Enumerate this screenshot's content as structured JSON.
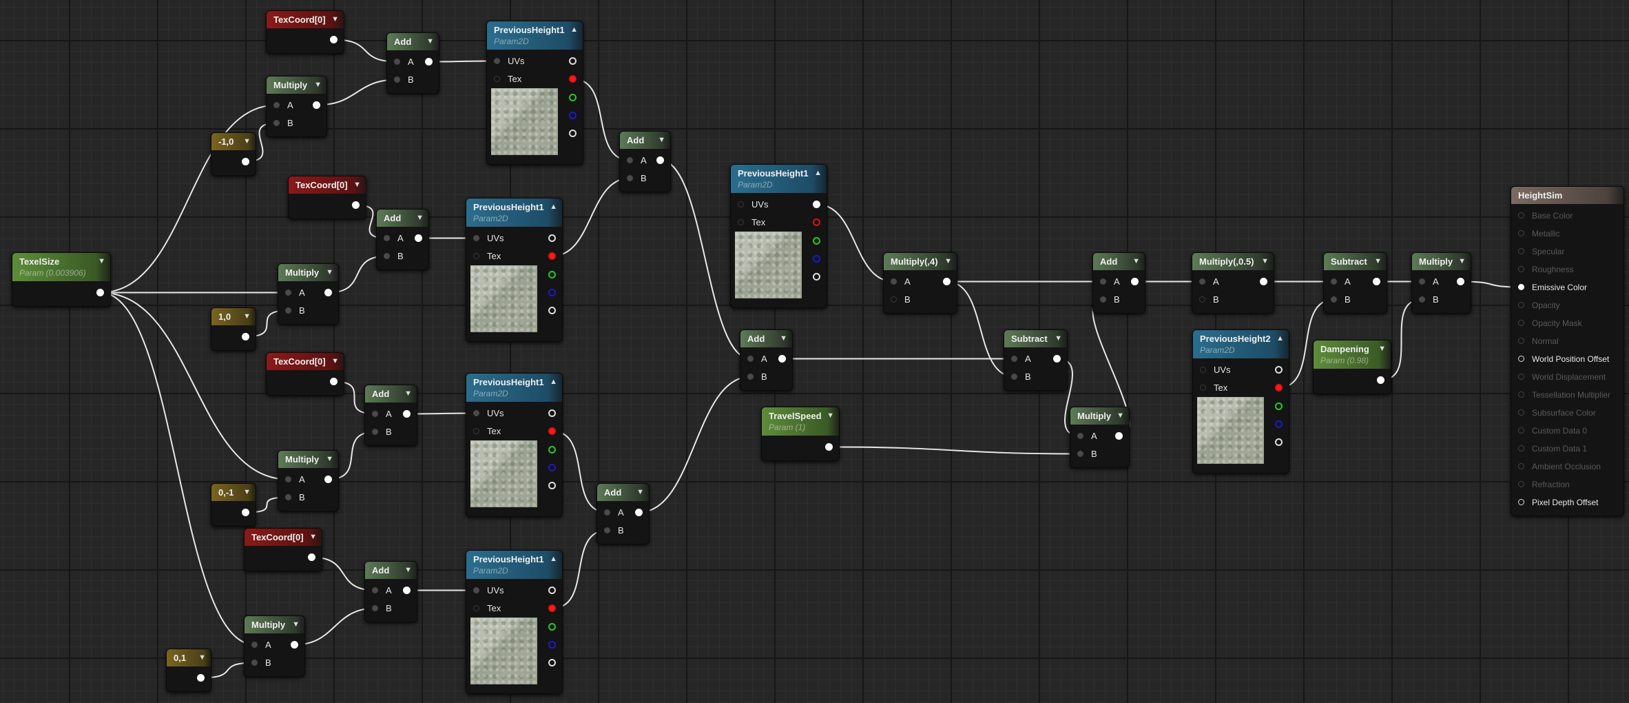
{
  "nodes": [
    {
      "kind": "texcoord",
      "title": "TexCoord[0]"
    },
    {
      "kind": "math",
      "title": "Add",
      "inputs": [
        "A",
        "B"
      ]
    },
    {
      "kind": "texture",
      "title": "PreviousHeight1",
      "subtitle": "Param2D",
      "inputs": [
        "UVs",
        "Tex"
      ]
    },
    {
      "kind": "math",
      "title": "Multiply",
      "inputs": [
        "A",
        "B"
      ]
    },
    {
      "kind": "const",
      "title": "-1,0"
    },
    {
      "kind": "math",
      "title": "Add",
      "inputs": [
        "A",
        "B"
      ]
    },
    {
      "kind": "texcoord",
      "title": "TexCoord[0]"
    },
    {
      "kind": "math",
      "title": "Add",
      "inputs": [
        "A",
        "B"
      ]
    },
    {
      "kind": "texture",
      "title": "PreviousHeight1",
      "subtitle": "Param2D",
      "inputs": [
        "UVs",
        "Tex"
      ]
    },
    {
      "kind": "texture",
      "title": "PreviousHeight1",
      "subtitle": "Param2D",
      "inputs": [
        "UVs",
        "Tex"
      ]
    },
    {
      "kind": "param",
      "title": "TexelSize",
      "subtitle": "Param (0.003906)"
    },
    {
      "kind": "math",
      "title": "Multiply",
      "inputs": [
        "A",
        "B"
      ]
    },
    {
      "kind": "const",
      "title": "1,0"
    },
    {
      "kind": "math",
      "title": "Multiply(,4)",
      "inputs": [
        "A",
        "B"
      ]
    },
    {
      "kind": "math",
      "title": "Add",
      "inputs": [
        "A",
        "B"
      ]
    },
    {
      "kind": "math",
      "title": "Multiply(,0.5)",
      "inputs": [
        "A",
        "B"
      ]
    },
    {
      "kind": "math",
      "title": "Subtract",
      "inputs": [
        "A",
        "B"
      ]
    },
    {
      "kind": "math",
      "title": "Multiply",
      "inputs": [
        "A",
        "B"
      ]
    },
    {
      "kind": "material",
      "title": "HeightSim",
      "inputs": [
        {
          "label": "Base Color",
          "enabled": false
        },
        {
          "label": "Metallic",
          "enabled": false
        },
        {
          "label": "Specular",
          "enabled": false
        },
        {
          "label": "Roughness",
          "enabled": false
        },
        {
          "label": "Emissive Color",
          "enabled": true
        },
        {
          "label": "Opacity",
          "enabled": false
        },
        {
          "label": "Opacity Mask",
          "enabled": false
        },
        {
          "label": "Normal",
          "enabled": false
        },
        {
          "label": "World Position Offset",
          "enabled": true
        },
        {
          "label": "World Displacement",
          "enabled": false
        },
        {
          "label": "Tessellation Multiplier",
          "enabled": false
        },
        {
          "label": "Subsurface Color",
          "enabled": false
        },
        {
          "label": "Custom Data 0",
          "enabled": false
        },
        {
          "label": "Custom Data 1",
          "enabled": false
        },
        {
          "label": "Ambient Occlusion",
          "enabled": false
        },
        {
          "label": "Refraction",
          "enabled": false
        },
        {
          "label": "Pixel Depth Offset",
          "enabled": true
        }
      ]
    },
    {
      "kind": "math",
      "title": "Add",
      "inputs": [
        "A",
        "B"
      ]
    },
    {
      "kind": "math",
      "title": "Subtract",
      "inputs": [
        "A",
        "B"
      ]
    },
    {
      "kind": "texture",
      "title": "PreviousHeight2",
      "subtitle": "Param2D",
      "inputs": [
        "UVs",
        "Tex"
      ]
    },
    {
      "kind": "param",
      "title": "Dampening",
      "subtitle": "Param (0.98)"
    },
    {
      "kind": "texcoord",
      "title": "TexCoord[0]"
    },
    {
      "kind": "math",
      "title": "Add",
      "inputs": [
        "A",
        "B"
      ]
    },
    {
      "kind": "texture",
      "title": "PreviousHeight1",
      "subtitle": "Param2D",
      "inputs": [
        "UVs",
        "Tex"
      ]
    },
    {
      "kind": "param",
      "title": "TravelSpeed",
      "subtitle": "Param (1)"
    },
    {
      "kind": "math",
      "title": "Multiply",
      "inputs": [
        "A",
        "B"
      ]
    },
    {
      "kind": "math",
      "title": "Multiply",
      "inputs": [
        "A",
        "B"
      ]
    },
    {
      "kind": "const",
      "title": "0,-1"
    },
    {
      "kind": "math",
      "title": "Add",
      "inputs": [
        "A",
        "B"
      ]
    },
    {
      "kind": "texcoord",
      "title": "TexCoord[0]"
    },
    {
      "kind": "math",
      "title": "Add",
      "inputs": [
        "A",
        "B"
      ]
    },
    {
      "kind": "texture",
      "title": "PreviousHeight1",
      "subtitle": "Param2D",
      "inputs": [
        "UVs",
        "Tex"
      ]
    },
    {
      "kind": "math",
      "title": "Multiply",
      "inputs": [
        "A",
        "B"
      ]
    },
    {
      "kind": "const",
      "title": "0,1"
    }
  ],
  "colors": {
    "background": "#262626",
    "wire": "#e8e8e8",
    "math_header": "#5d7a56",
    "texcoord_header": "#8a1a1a",
    "const_header": "#7a6420",
    "param_header": "#5e8c3a",
    "texture_header": "#2b6d8e",
    "material_header": "#7a6a62"
  },
  "icons": {
    "collapse": "chevron-down-icon",
    "expand": "chevron-up-icon"
  }
}
